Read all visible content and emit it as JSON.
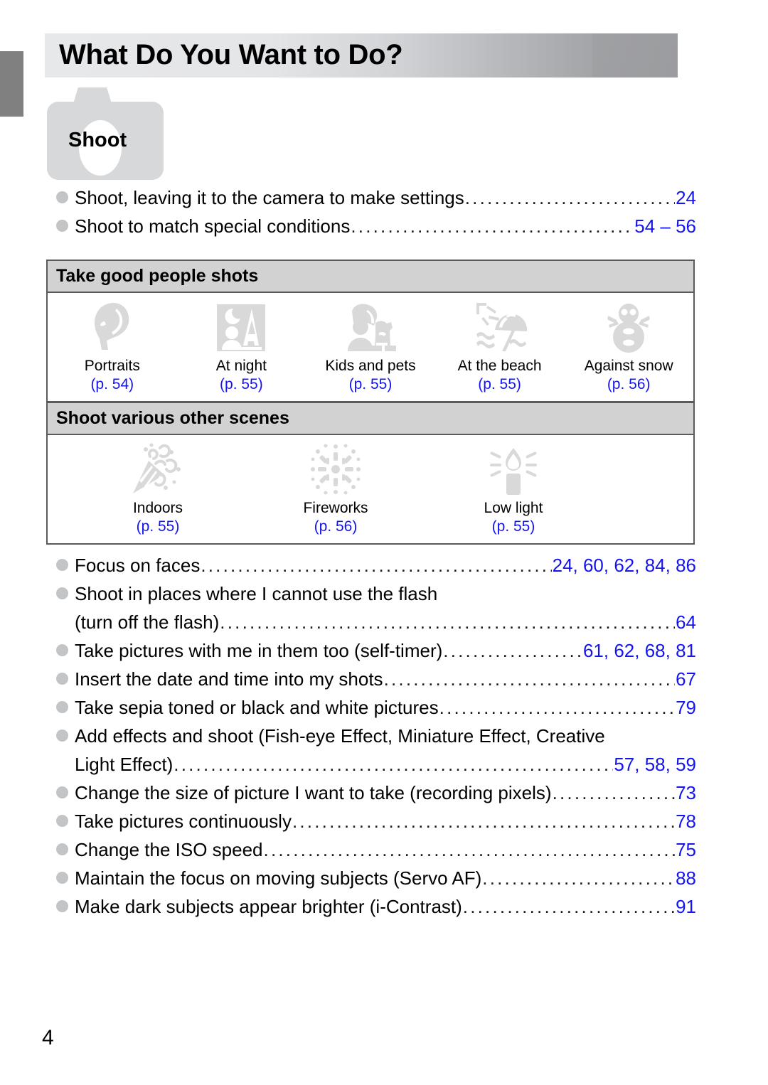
{
  "page": {
    "title": "What Do You Want to Do?",
    "page_number": "4",
    "badge_label": "Shoot",
    "accent_color": "#1414f0",
    "header_band_color": "#d2d2d2",
    "icon_gray": "#d9d9d9"
  },
  "top_entries": [
    {
      "text": "Shoot, leaving it to the camera to make settings",
      "pages": "24"
    },
    {
      "text": "Shoot to match special conditions",
      "pages": "54 – 56"
    }
  ],
  "tables": [
    {
      "heading": "Take good people shots",
      "items": [
        {
          "label": "Portraits",
          "page": "(p. 54)",
          "icon": "portrait-face-icon"
        },
        {
          "label": "At night",
          "page": "(p. 55)",
          "icon": "night-scene-icon"
        },
        {
          "label": "Kids and pets",
          "page": "(p. 55)",
          "icon": "kids-and-pets-icon"
        },
        {
          "label": "At the beach",
          "page": "(p. 55)",
          "icon": "beach-umbrella-icon"
        },
        {
          "label": "Against snow",
          "page": "(p. 56)",
          "icon": "snowman-icon"
        }
      ]
    },
    {
      "heading": "Shoot various other scenes",
      "items": [
        {
          "label": "Indoors",
          "page": "(p. 55)",
          "icon": "party-popper-icon"
        },
        {
          "label": "Fireworks",
          "page": "(p. 56)",
          "icon": "fireworks-icon"
        },
        {
          "label": "Low light",
          "page": "(p. 55)",
          "icon": "candle-icon"
        }
      ]
    }
  ],
  "bottom_entries": [
    {
      "lines": [
        "Focus on faces"
      ],
      "pages": "24, 60, 62, 84, 86"
    },
    {
      "lines": [
        "Shoot in places where I cannot use the flash",
        "(turn off the flash)"
      ],
      "pages": "64"
    },
    {
      "lines": [
        "Take pictures with me in them too (self-timer)"
      ],
      "pages": "61, 62, 68, 81"
    },
    {
      "lines": [
        "Insert the date and time into my shots"
      ],
      "pages": "67"
    },
    {
      "lines": [
        "Take sepia toned or black and white pictures"
      ],
      "pages": "79"
    },
    {
      "lines": [
        "Add effects and shoot (Fish-eye Effect, Miniature Effect, Creative",
        "Light Effect)"
      ],
      "pages": "57, 58, 59"
    },
    {
      "lines": [
        "Change the size of picture I want to take (recording pixels)"
      ],
      "pages": "73"
    },
    {
      "lines": [
        "Take pictures continuously"
      ],
      "pages": "78"
    },
    {
      "lines": [
        "Change the ISO speed"
      ],
      "pages": "75"
    },
    {
      "lines": [
        "Maintain the focus on moving subjects (Servo AF)"
      ],
      "pages": "88"
    },
    {
      "lines": [
        "Make dark subjects appear brighter (i-Contrast)"
      ],
      "pages": "91"
    }
  ]
}
